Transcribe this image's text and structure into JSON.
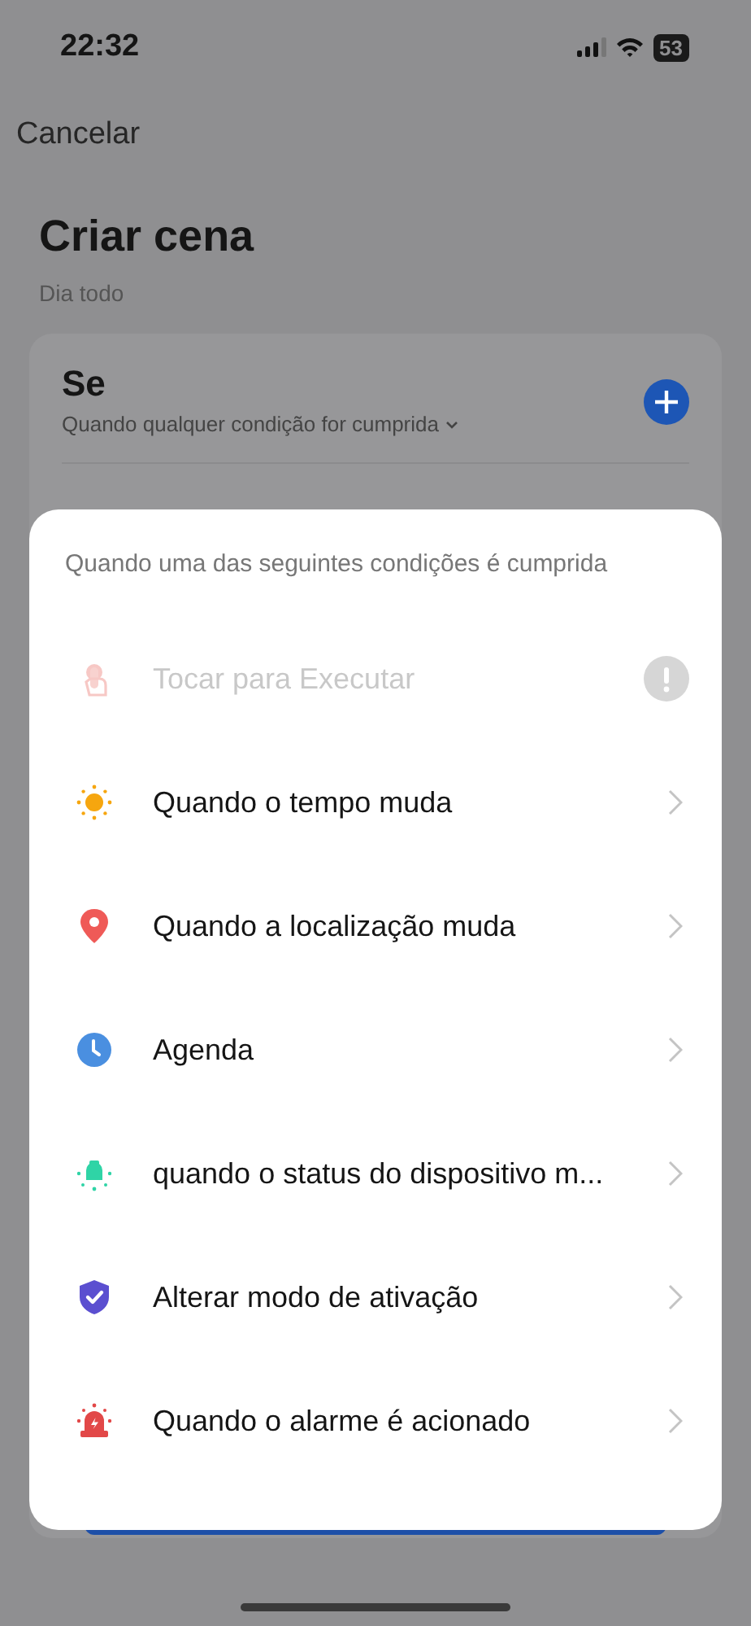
{
  "status_bar": {
    "time": "22:32",
    "battery": "53"
  },
  "nav": {
    "cancel": "Cancelar"
  },
  "page": {
    "title": "Criar cena",
    "subtitle": "Dia todo"
  },
  "condition_card": {
    "title": "Se",
    "mode": "Quando qualquer condição for cumprida"
  },
  "sheet": {
    "heading": "Quando uma das seguintes condições é cumprida",
    "items": [
      {
        "kind": "touch",
        "label": "Tocar para Executar",
        "disabled": true
      },
      {
        "kind": "weather",
        "label": "Quando o tempo muda",
        "disabled": false
      },
      {
        "kind": "location",
        "label": "Quando a localização muda",
        "disabled": false
      },
      {
        "kind": "schedule",
        "label": "Agenda",
        "disabled": false
      },
      {
        "kind": "device",
        "label": "quando o status do dispositivo m...",
        "disabled": false
      },
      {
        "kind": "mode",
        "label": "Alterar modo de ativação",
        "disabled": false
      },
      {
        "kind": "alarm",
        "label": "Quando o alarme é acionado",
        "disabled": false
      }
    ]
  }
}
